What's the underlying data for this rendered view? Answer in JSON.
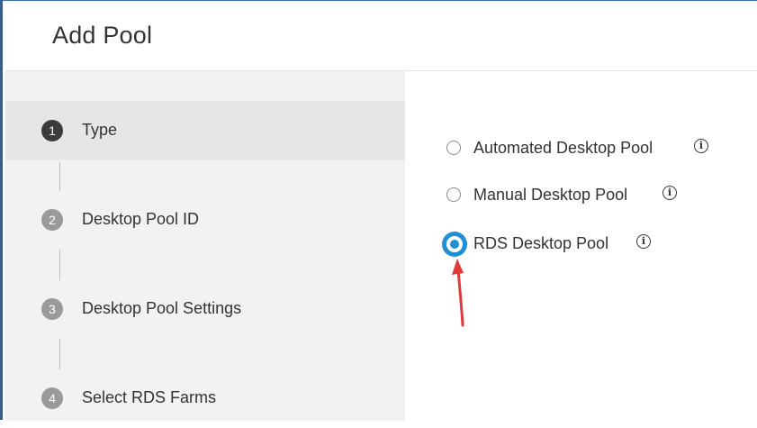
{
  "dialog": {
    "title": "Add Pool"
  },
  "steps": [
    {
      "number": "1",
      "label": "Type",
      "active": true
    },
    {
      "number": "2",
      "label": "Desktop Pool ID",
      "active": false
    },
    {
      "number": "3",
      "label": "Desktop Pool Settings",
      "active": false
    },
    {
      "number": "4",
      "label": "Select RDS Farms",
      "active": false
    }
  ],
  "pool_types": {
    "options": [
      {
        "label": "Automated Desktop Pool",
        "selected": false,
        "info_icon": "info-icon"
      },
      {
        "label": "Manual Desktop Pool",
        "selected": false,
        "info_icon": "info-icon"
      },
      {
        "label": "RDS Desktop Pool",
        "selected": true,
        "info_icon": "info-icon"
      }
    ]
  },
  "annotation": {
    "arrow_icon": "red-arrow-icon",
    "arrow_color": "#e03a3a"
  },
  "colors": {
    "accent": "#1f8fd6",
    "frame_border": "#3b5d8c",
    "sidebar_bg": "#f2f2f2",
    "active_step_bg": "#e6e6e6"
  }
}
